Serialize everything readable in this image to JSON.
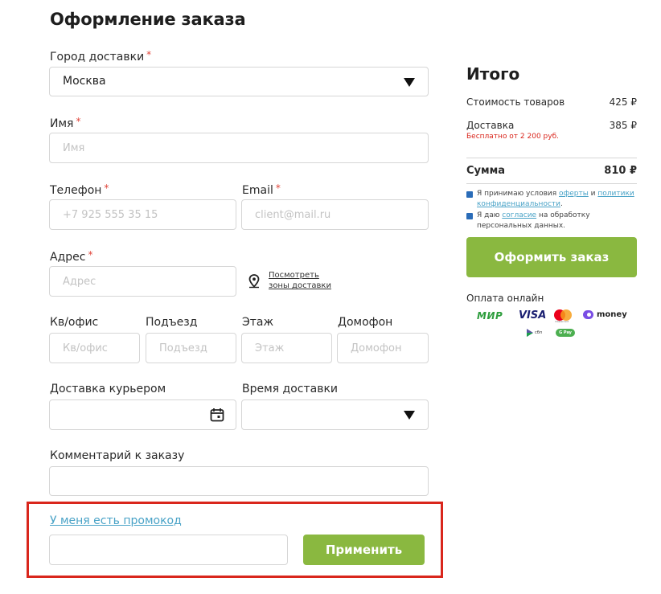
{
  "page": {
    "title": "Оформление заказа"
  },
  "form": {
    "city": {
      "label": "Город доставки",
      "required_mark": "*",
      "value": "Москва"
    },
    "name": {
      "label": "Имя",
      "required_mark": "*",
      "placeholder": "Имя"
    },
    "phone": {
      "label": "Телефон",
      "required_mark": "*",
      "placeholder": "+7 925 555 35 15"
    },
    "email": {
      "label": "Email",
      "required_mark": "*",
      "placeholder": "client@mail.ru"
    },
    "address": {
      "label": "Адрес",
      "required_mark": "*",
      "placeholder": "Адрес",
      "zone_link_line1": "Посмотреть",
      "zone_link_line2": "зоны доставки"
    },
    "office": {
      "label": "Кв/офис",
      "placeholder": "Кв/офис"
    },
    "entrance": {
      "label": "Подъезд",
      "placeholder": "Подъезд"
    },
    "floor": {
      "label": "Этаж",
      "placeholder": "Этаж"
    },
    "intercom": {
      "label": "Домофон",
      "placeholder": "Домофон"
    },
    "courier_date": {
      "label": "Доставка курьером",
      "value": ""
    },
    "delivery_time": {
      "label": "Время доставки",
      "value": ""
    },
    "comment": {
      "label": "Комментарий к заказу",
      "value": ""
    }
  },
  "promo": {
    "link": "У меня есть промокод",
    "value": "",
    "apply_label": "Применить"
  },
  "summary": {
    "title": "Итого",
    "goods_label": "Стоимость товаров",
    "goods_value": "425 ₽",
    "delivery_label": "Доставка",
    "delivery_value": "385 ₽",
    "delivery_note": "Бесплатно от 2 200 руб.",
    "total_label": "Сумма",
    "total_value": "810 ₽",
    "consent1": {
      "prefix": "Я принимаю условия ",
      "link1": "оферты",
      "mid": " и ",
      "link2": "политики конфиденциальности",
      "suffix": "."
    },
    "consent2": {
      "prefix": "Я даю ",
      "link": "согласие",
      "suffix": " на обработку персональных данных."
    },
    "order_button": "Оформить заказ",
    "payment_title": "Оплата онлайн",
    "payment_logos": {
      "mir": "МИР",
      "visa": "VISA",
      "mastercard_caption": "mastercard",
      "yoomoney": "money",
      "sbp": "сбп",
      "gpay": "G Pay"
    }
  },
  "colors": {
    "accent_green": "#8ab840",
    "required_red": "#e0453a",
    "link_blue": "#4aa3c7",
    "highlight_red": "#d9261c"
  }
}
